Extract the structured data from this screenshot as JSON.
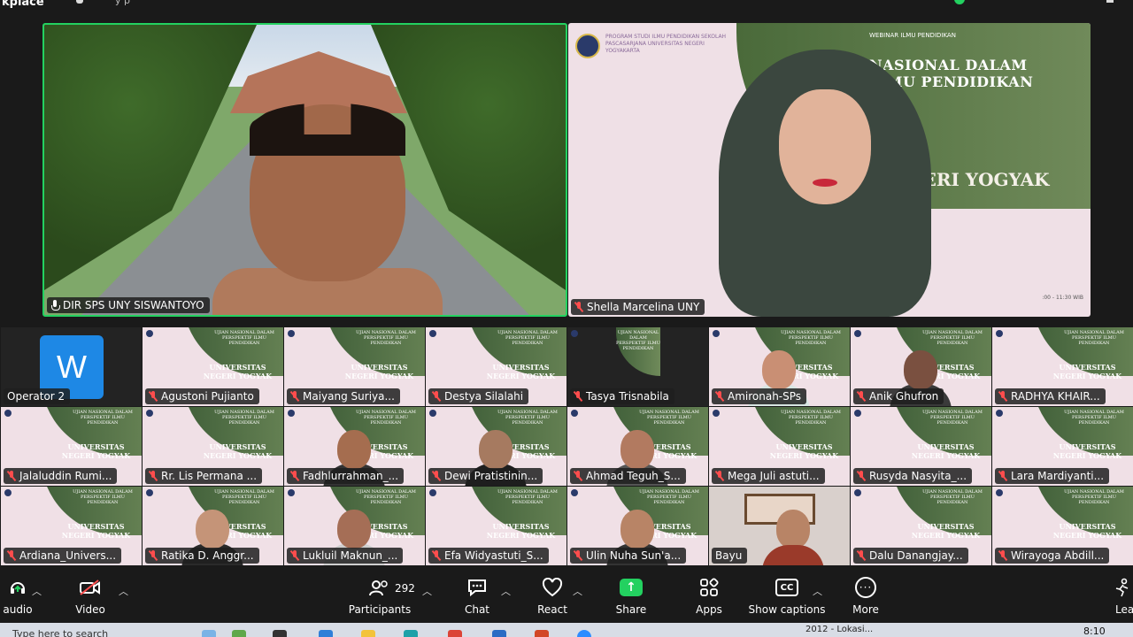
{
  "topbar": {
    "app_name": "kplace",
    "mid_text": "y p"
  },
  "speakers": [
    {
      "name": "DIR SPS UNY SISWANTOYO",
      "mic": "on",
      "active": true
    },
    {
      "name": "Shella Marcelina UNY",
      "mic": "muted",
      "active": false
    }
  ],
  "slide": {
    "subtitle": "WEBINAR ILMU PENDIDIKAN",
    "title": "NASIONAL DALAM ILMU PENDIDIKAN",
    "city": "NEGERI YOGYAK",
    "logo_text": "PROGRAM STUDI ILMU PENDIDIKAN SEKOLAH PASCASARJANA UNIVERSITAS NEGERI YOGYAKARTA",
    "time": ":00 - 11:30 WIB"
  },
  "tile_slide": {
    "text": "UJIAN NASIONAL DALAM PERSPEKTIF ILMU PENDIDIKAN",
    "city": "UNIVERSITAS NEGERI YOGYAK"
  },
  "participants": [
    {
      "name": "Operator 2",
      "mic": "none",
      "kind": "avatar",
      "avatar_letter": "W"
    },
    {
      "name": "Agustoni Pujianto",
      "mic": "muted",
      "kind": "slide"
    },
    {
      "name": "Maiyang Suriya...",
      "mic": "muted",
      "kind": "slide"
    },
    {
      "name": "Destya Silalahi",
      "mic": "muted",
      "kind": "slide"
    },
    {
      "name": "Tasya Trisnabila",
      "mic": "muted",
      "kind": "slide-dark"
    },
    {
      "name": "Amironah-SPs",
      "mic": "muted",
      "kind": "person"
    },
    {
      "name": "Anik Ghufron",
      "mic": "muted",
      "kind": "person"
    },
    {
      "name": "RADHYA KHAIR...",
      "mic": "muted",
      "kind": "slide"
    },
    {
      "name": "Jalaluddin Rumi...",
      "mic": "muted",
      "kind": "slide"
    },
    {
      "name": "Rr. Lis Permana ...",
      "mic": "muted",
      "kind": "slide"
    },
    {
      "name": "Fadhlurrahman_...",
      "mic": "muted",
      "kind": "person"
    },
    {
      "name": "Dewi Pratistinin...",
      "mic": "muted",
      "kind": "person"
    },
    {
      "name": "Ahmad Teguh_S...",
      "mic": "muted",
      "kind": "person"
    },
    {
      "name": "Mega Juli astuti...",
      "mic": "muted",
      "kind": "slide"
    },
    {
      "name": "Rusyda Nasyita_...",
      "mic": "muted",
      "kind": "slide"
    },
    {
      "name": "Lara Mardiyanti...",
      "mic": "muted",
      "kind": "slide"
    },
    {
      "name": "Ardiana_Univers...",
      "mic": "muted",
      "kind": "slide"
    },
    {
      "name": "Ratika D. Anggr...",
      "mic": "muted",
      "kind": "person"
    },
    {
      "name": "Lukluil Maknun_...",
      "mic": "muted",
      "kind": "person"
    },
    {
      "name": "Efa Widyastuti_S...",
      "mic": "muted",
      "kind": "slide"
    },
    {
      "name": "Ulin Nuha Sun'a...",
      "mic": "muted",
      "kind": "person"
    },
    {
      "name": "Bayu",
      "mic": "none",
      "kind": "photo"
    },
    {
      "name": "Dalu Danangjay...",
      "mic": "muted",
      "kind": "slide"
    },
    {
      "name": "Wirayoga Abdill...",
      "mic": "muted",
      "kind": "slide"
    }
  ],
  "toolbar": {
    "audio_label": "audio",
    "video_label": "Video",
    "participants_label": "Participants",
    "participants_count": "292",
    "chat_label": "Chat",
    "react_label": "React",
    "share_label": "Share",
    "apps_label": "Apps",
    "captions_label": "Show captions",
    "more_label": "More",
    "leave_label": "Leav"
  },
  "taskbar": {
    "time": "8:10",
    "search_text": "Type here to search",
    "window_text": "2012 - Lokasi..."
  },
  "colors": {
    "active_border": "#23d160",
    "muted_mic": "#ff4d4d",
    "share_green": "#23d160",
    "avatar_blue": "#1e88e5"
  }
}
